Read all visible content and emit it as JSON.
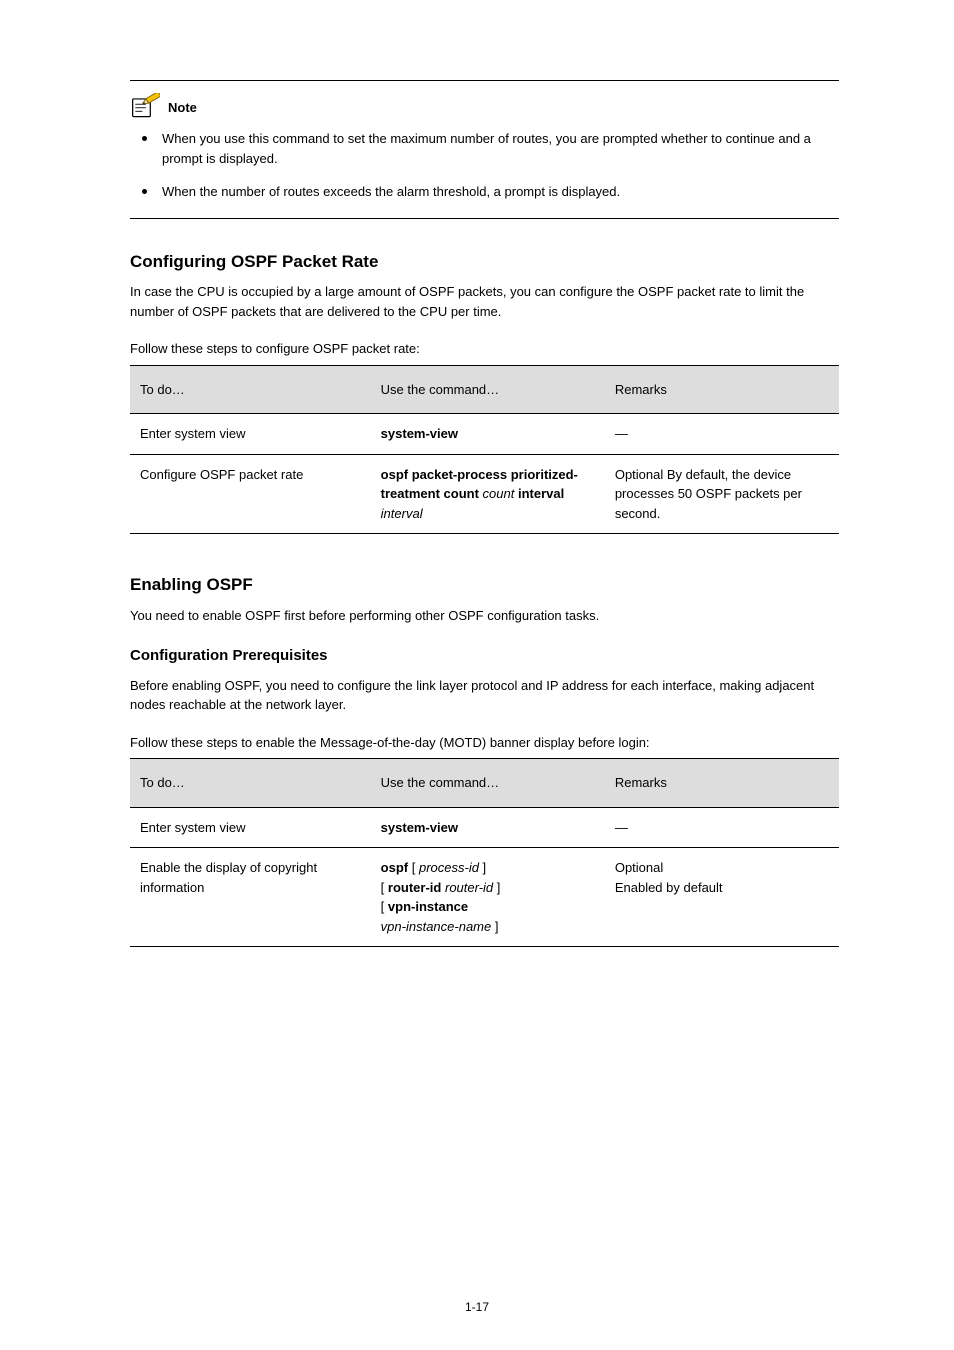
{
  "note": {
    "label": "Note",
    "items": [
      "When you use this command to set the maximum number of routes, you are prompted whether to continue and a prompt is displayed.",
      "When the number of routes exceeds the alarm threshold, a prompt is displayed."
    ]
  },
  "sections": [
    {
      "title": "Configuring OSPF Packet Rate",
      "intro": "In case the CPU is occupied by a large amount of OSPF packets, you can configure the OSPF packet rate to limit the number of OSPF packets that are delivered to the CPU per time.",
      "follow": "Follow these steps to configure OSPF packet rate:",
      "table": {
        "headers": [
          "To do…",
          "Use the command…",
          "Remarks"
        ],
        "rows": [
          {
            "to_do": "Enter system view",
            "cmd_html": "<span class=\"cmd\">system-view</span>",
            "remarks": "—"
          },
          {
            "to_do": "Configure OSPF packet rate",
            "cmd_html": "<span class=\"cmd\">ospf packet-process prioritized-treatment count</span> <span class=\"cmd-arg\">count</span> <span class=\"cmd\">interval</span> <span class=\"cmd-arg\">interval</span>",
            "remarks": "Optional\nBy default, the device processes 50 OSPF packets per second."
          }
        ]
      }
    },
    {
      "title": "Enabling OSPF",
      "intro": "You need to enable OSPF first before performing other OSPF configuration tasks.",
      "subheading": "Configuration Prerequisites",
      "sub_intro": "Before enabling OSPF, you need to configure the link layer protocol and IP address for each interface, making adjacent nodes reachable at the network layer.",
      "follow": "Follow these steps to enable the Message-of-the-day (MOTD) banner display before login:",
      "table": {
        "headers": [
          "To do…",
          "Use the command…",
          "Remarks"
        ],
        "rows": [
          {
            "to_do": "Enter system view",
            "cmd_html": "<span class=\"cmd\">system-view</span>",
            "remarks": "—"
          },
          {
            "to_do": "Enable the display of copyright information",
            "cmd_html": "<span class=\"cmd\">ospf</span> [ <span class=\"cmd-arg\">process-id</span> ]\n[ <span class=\"cmd\">router-id</span> <span class=\"cmd-arg\">router-id</span> ]\n[ <span class=\"cmd\">vpn-instance</span>\n<span class=\"cmd-arg\">vpn-instance-name</span> ]",
            "remarks": "Optional\nEnabled by default"
          }
        ]
      }
    }
  ],
  "page_number": "1-17"
}
